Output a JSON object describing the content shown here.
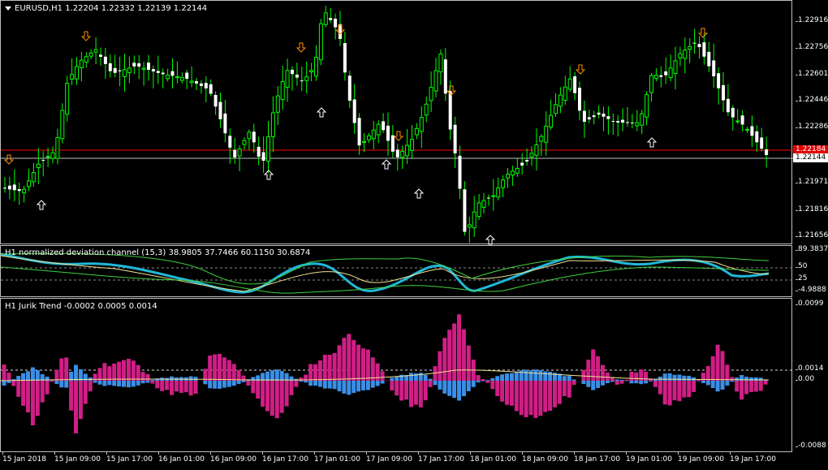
{
  "chart": {
    "symbol_line": "EURUSD,H1  1.22204 1.22332 1.22139 1.22144",
    "price_ticks": [
      "1.22916",
      "1.22756",
      "1.22601",
      "1.22446",
      "1.22286",
      "1.22131",
      "1.21971",
      "1.21816",
      "1.21656"
    ],
    "bid_badge": "1.22144",
    "ask_badge": "1.22184",
    "colors": {
      "bull_candle": "#ffffff",
      "bear_candle": "#ffffff",
      "wick": "#00ff00",
      "ask_line": "#ff0000",
      "bid_line": "#c0c0c0",
      "up_arrow": "#ffffff",
      "down_arrow": "#ff8c00"
    }
  },
  "ndc": {
    "title": "H1  normalized deviation channel (15,3) 38.9805 37.7466 60.1150 30.6874",
    "ticks": [
      "89.3837",
      "50",
      "25",
      "-4.9888"
    ]
  },
  "jurik": {
    "title": "H1   Jurik Trend  -0.0002 0.0005 0.0014",
    "ticks": [
      "0.0099",
      "0.0014",
      "0.00",
      "-0.0088"
    ],
    "colors": {
      "positive": "#d11e86",
      "negative": "#3a8fe8"
    }
  },
  "time_axis": [
    "15 Jan 2018",
    "15 Jan 09:00",
    "15 Jan 17:00",
    "16 Jan 01:00",
    "16 Jan 09:00",
    "16 Jan 17:00",
    "17 Jan 01:00",
    "17 Jan 09:00",
    "17 Jan 17:00",
    "18 Jan 01:00",
    "18 Jan 09:00",
    "18 Jan 17:00",
    "19 Jan 01:00",
    "19 Jan 09:00",
    "19 Jan 17:00"
  ]
}
